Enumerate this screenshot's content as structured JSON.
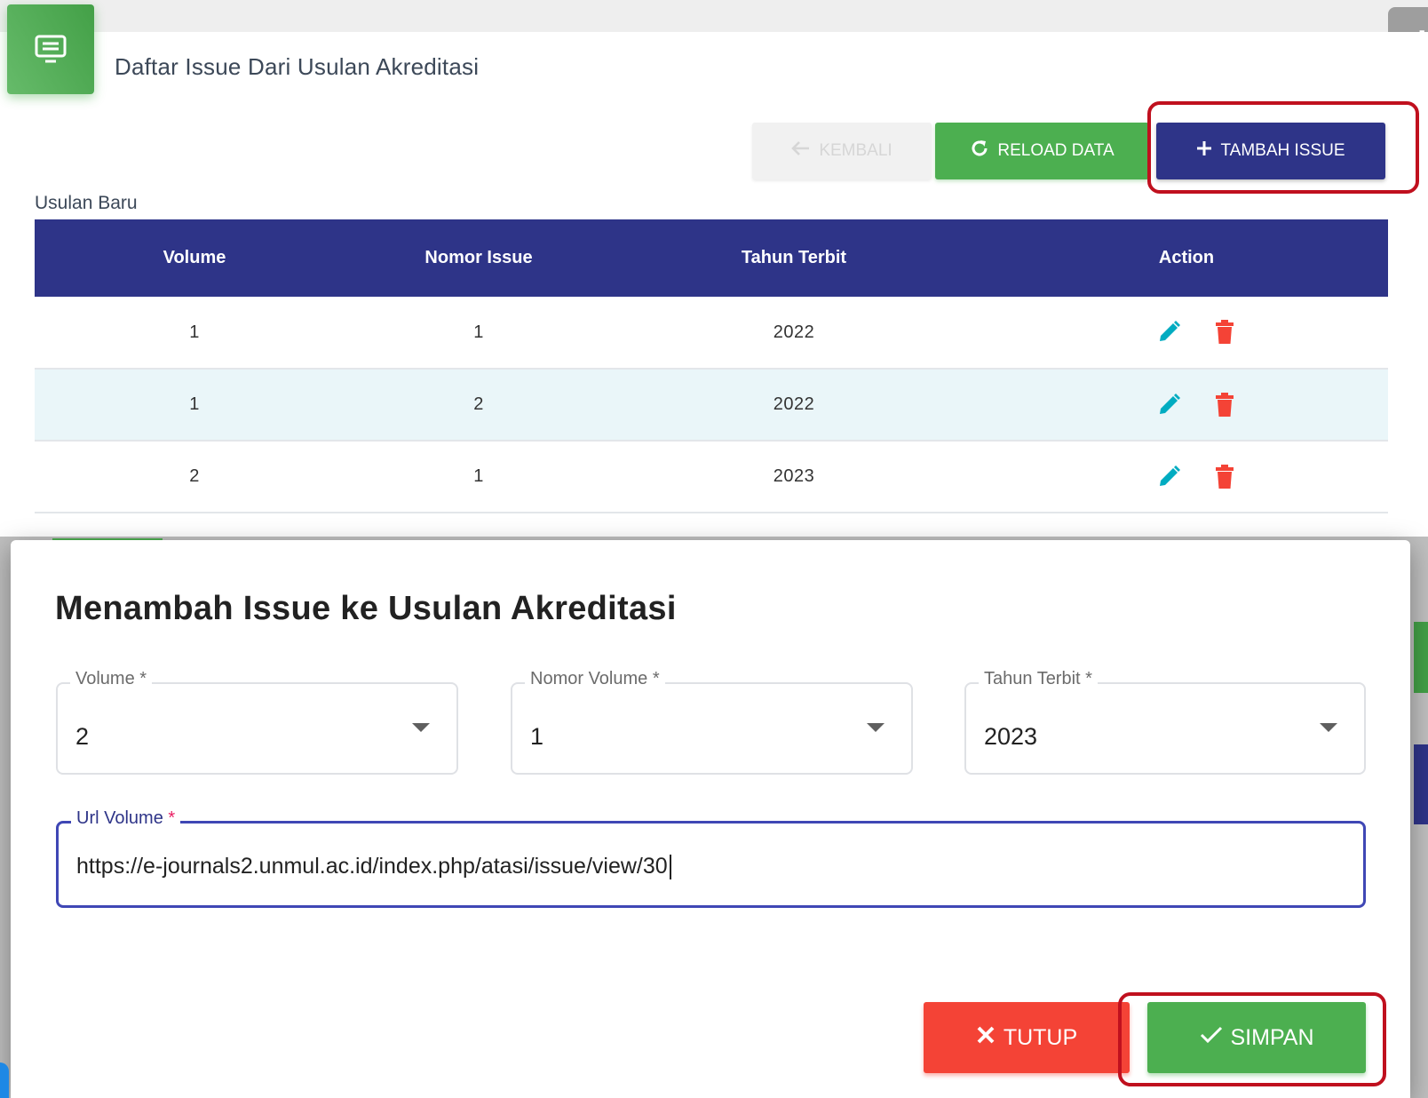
{
  "header": {
    "title": "Daftar Issue Dari Usulan Akreditasi",
    "card_icon": "monitor-list-icon",
    "corner_icon": "puzzle-icon"
  },
  "toolbar": {
    "kembali_label": "KEMBALI",
    "reload_label": "RELOAD DATA",
    "tambah_label": "TAMBAH ISSUE"
  },
  "section_label": "Usulan Baru",
  "table": {
    "columns": [
      "Volume",
      "Nomor Issue",
      "Tahun Terbit",
      "Action"
    ],
    "rows": [
      {
        "volume": "1",
        "nomor": "1",
        "tahun": "2022"
      },
      {
        "volume": "1",
        "nomor": "2",
        "tahun": "2022"
      },
      {
        "volume": "2",
        "nomor": "1",
        "tahun": "2023"
      }
    ]
  },
  "modal": {
    "title": "Menambah Issue ke Usulan Akreditasi",
    "fields": {
      "volume": {
        "label": "Volume",
        "value": "2"
      },
      "nomor_volume": {
        "label": "Nomor Volume",
        "value": "1"
      },
      "tahun_terbit": {
        "label": "Tahun Terbit",
        "value": "2023"
      },
      "url_volume": {
        "label": "Url Volume",
        "value": "https://e-journals2.unmul.ac.id/index.php/atasi/issue/view/30"
      }
    },
    "required_mark": "*",
    "tutup_label": "TUTUP",
    "simpan_label": "SIMPAN"
  },
  "colors": {
    "primary": "#2e3488",
    "success": "#4caf50",
    "danger": "#f44336",
    "edit_icon": "#00acc1",
    "highlight": "#c0101e"
  }
}
